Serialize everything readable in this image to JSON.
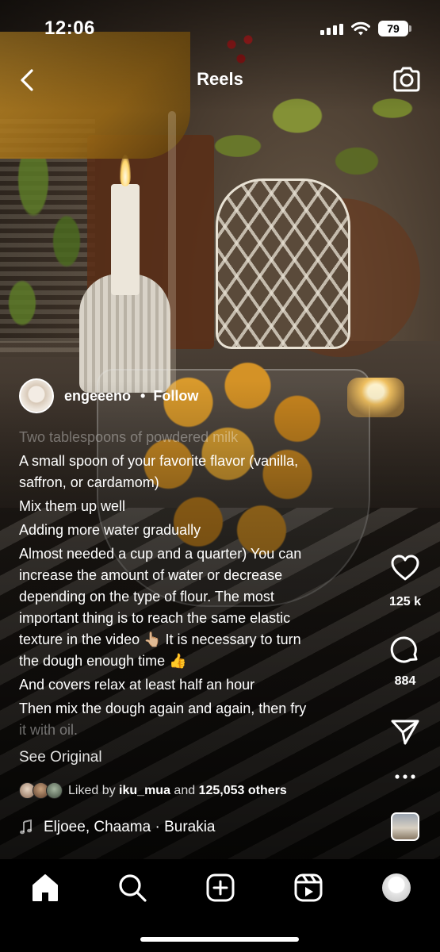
{
  "status_bar": {
    "time": "12:06",
    "battery": "79"
  },
  "header": {
    "title": "Reels",
    "back_icon": "chevron-left-icon",
    "camera_icon": "camera-icon"
  },
  "author": {
    "username": "engeeeno",
    "separator": "•",
    "follow_label": "Follow"
  },
  "caption": {
    "faded_top": "Two tablespoons of powdered milk",
    "paragraphs": [
      [
        "A small spoon of your favorite flavor (vanilla,",
        "saffron, or cardamom)"
      ],
      [
        "Mix them up well"
      ],
      [
        "Adding more water gradually"
      ],
      [
        "Almost needed a cup and a quarter) You can",
        "increase the amount of water or decrease",
        "depending on the type of flour. The most",
        "important thing is to reach the same elastic",
        "texture in the video 👆🏼  It is necessary to turn",
        "the dough enough time 👍"
      ],
      [
        "And covers relax at least half an hour"
      ],
      [
        "Then mix the dough again and again, then fry"
      ]
    ],
    "faded_bottom": "it with oil."
  },
  "see_original": "See Original",
  "liked": {
    "prefix": "Liked by",
    "user": "iku_mua",
    "middle": "and",
    "others": "125,053 others"
  },
  "music": {
    "track": "Eljoee, Chaama · Burakia"
  },
  "rail": {
    "like_count": "125 k",
    "comment_count": "884"
  },
  "nav": {
    "items": [
      "home-icon",
      "search-icon",
      "create-icon",
      "reels-icon",
      "profile-icon"
    ]
  },
  "colors": {
    "accent_dot": "#ff2d4f",
    "nav_bg": "#000000",
    "text": "#ffffff"
  }
}
